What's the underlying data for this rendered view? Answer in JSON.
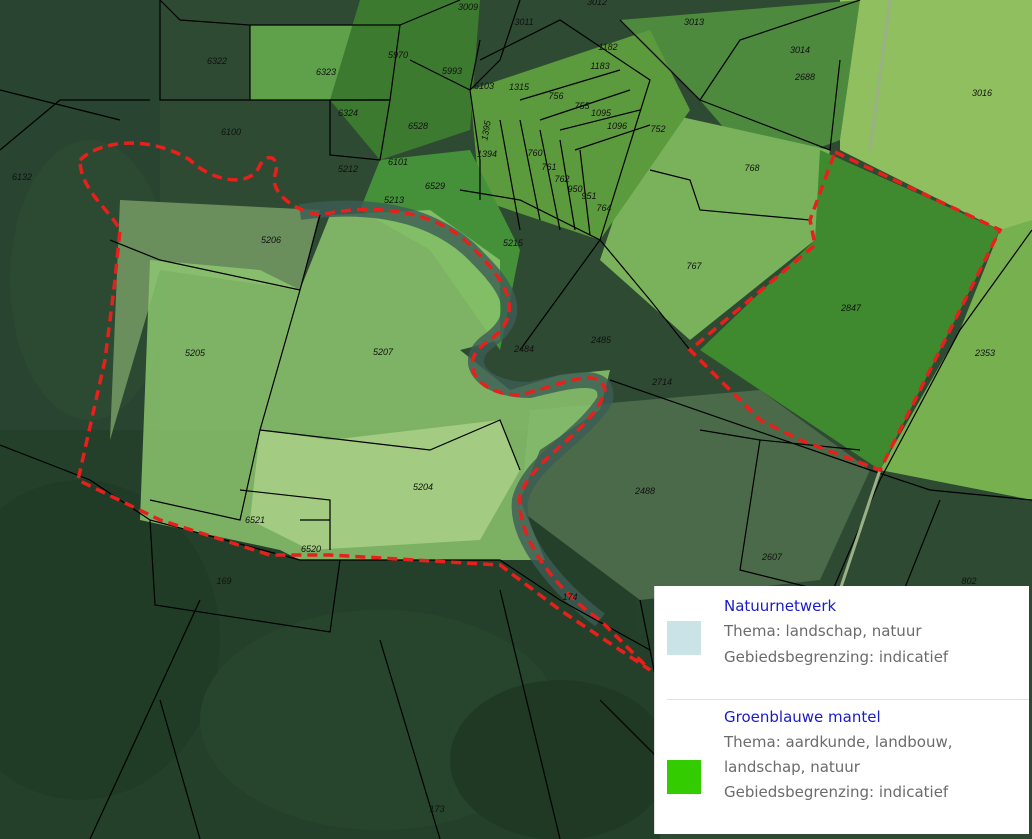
{
  "map": {
    "parcel_labels": [
      "3009",
      "3011",
      "3012",
      "3013",
      "6322",
      "6323",
      "5970",
      "5993",
      "6103",
      "1315",
      "756",
      "1182",
      "1183",
      "755",
      "1095",
      "1096",
      "752",
      "3014",
      "2688",
      "3016",
      "6100",
      "6324",
      "6528",
      "1395",
      "1394",
      "760",
      "761",
      "762",
      "950",
      "951",
      "764",
      "768",
      "6132",
      "5212",
      "6101",
      "6529",
      "5213",
      "5206",
      "5215",
      "767",
      "2847",
      "5205",
      "5207",
      "2484",
      "2485",
      "2714",
      "2353",
      "2488",
      "5204",
      "6521",
      "6520",
      "169",
      "2607",
      "174",
      "802",
      "173"
    ],
    "boundary_color": "#e8201c"
  },
  "legend": {
    "items": [
      {
        "title": "Natuurnetwerk",
        "line1": "Thema: landschap, natuur",
        "line2": "Gebiedsbegrenzing: indicatief",
        "line3": "",
        "color": "#c9e3e6"
      },
      {
        "title": "Groenblauwe mantel",
        "line1": "Thema: aardkunde, landbouw,",
        "line2": "landschap, natuur",
        "line3": "Gebiedsbegrenzing: indicatief",
        "color": "#33cc00"
      }
    ]
  }
}
